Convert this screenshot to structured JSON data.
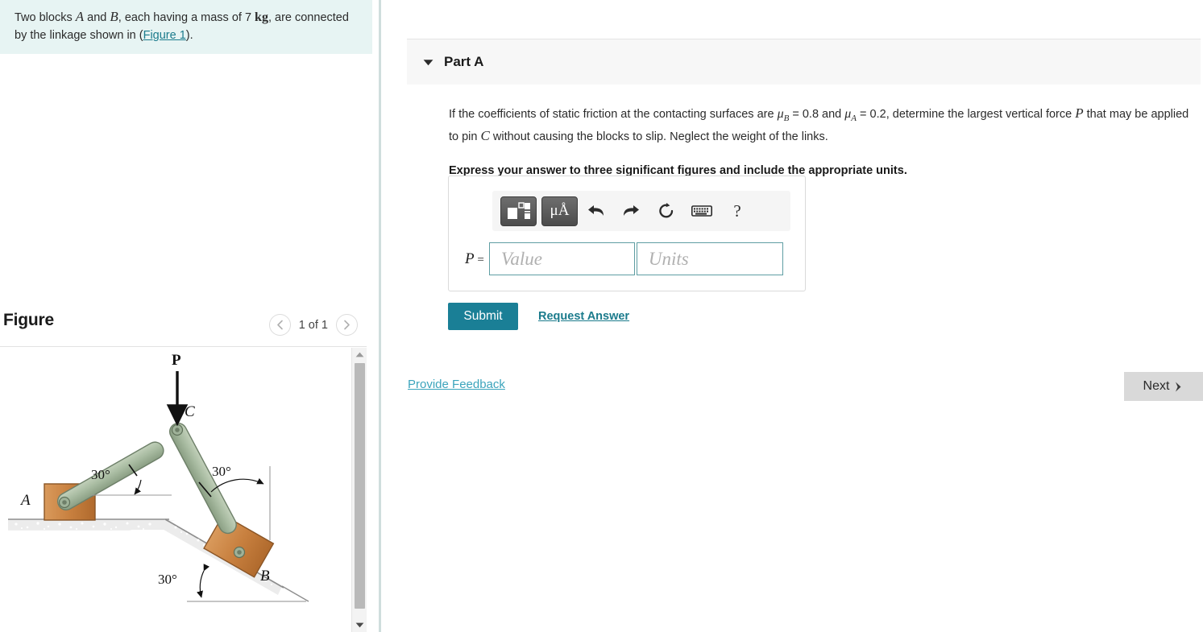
{
  "problem": {
    "text_1": "Two blocks ",
    "var_a": "A",
    "text_2": " and ",
    "var_b": "B",
    "text_3": ", each having a mass of 7 ",
    "unit_kg": "kg",
    "text_4": ", are connected by the linkage shown in (",
    "figure_link": "Figure 1",
    "text_5": ")."
  },
  "figure": {
    "title": "Figure",
    "counter": "1 of 1",
    "prev_icon": "chevron-left-icon",
    "next_icon": "chevron-right-icon",
    "diagram": {
      "force_label": "P",
      "pin_label": "C",
      "block_a_label": "A",
      "block_b_label": "B",
      "angle_link_ac": "30°",
      "angle_link_cb": "30°",
      "angle_incline": "30°",
      "colors": {
        "link": "#a9bca2",
        "link_edge": "#6d7f68",
        "block": "#c8803f",
        "block_edge": "#8a5526",
        "ground": "#e8e8e8"
      }
    }
  },
  "part": {
    "caret_icon": "caret-down-icon",
    "label": "Part A",
    "question": {
      "t1": "If the coefficients of static friction at the contacting surfaces are ",
      "mu_b": "μ",
      "mu_b_sub": "B",
      "v1": " = 0.8 and ",
      "mu_a": "μ",
      "mu_a_sub": "A",
      "v2": " = 0.2, determine the largest vertical force ",
      "force": "P",
      "t2": " that may be applied to pin ",
      "pin": "C",
      "t3": " without causing the blocks to slip. Neglect the weight of the links."
    },
    "instruction": "Express your answer to three significant figures and include the appropriate units."
  },
  "toolbar": {
    "template_icon": "math-template-icon",
    "units_icon": "μÅ",
    "undo_icon": "undo-icon",
    "redo_icon": "redo-icon",
    "reset_icon": "reset-icon",
    "keyboard_icon": "keyboard-icon",
    "help_icon": "?"
  },
  "answer": {
    "label_var": "P",
    "label_eq": " = ",
    "value_placeholder": "Value",
    "value": "",
    "units_placeholder": "Units",
    "units": ""
  },
  "actions": {
    "submit": "Submit",
    "request_answer": "Request Answer",
    "provide_feedback": "Provide Feedback",
    "next": "Next",
    "next_icon": "chevron-right-icon"
  },
  "colors": {
    "accent": "#1a7f96",
    "link": "#1b7b8c",
    "panel_bg": "#e7f4f3",
    "header_bg": "#f7f7f7",
    "field_border": "#5f9ea3"
  }
}
